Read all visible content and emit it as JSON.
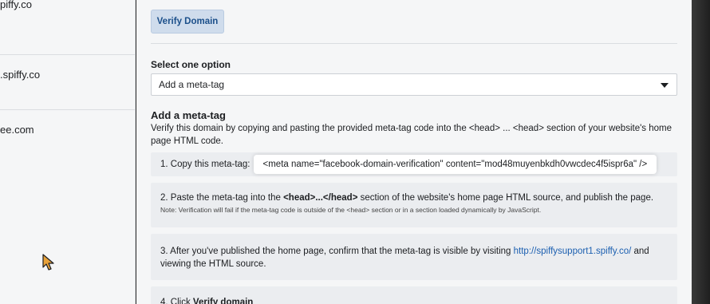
{
  "sidebar": {
    "items": [
      {
        "label": "piffy.co"
      },
      {
        "label": ".spiffy.co"
      },
      {
        "label": "ee.com"
      }
    ]
  },
  "main": {
    "verify_button": "Verify Domain",
    "select_label": "Select one option",
    "select_value": "Add a meta-tag",
    "section_title": "Add a meta-tag",
    "section_desc": "Verify this domain by copying and pasting the provided meta-tag code into the <head> ... <head> section of your website's home page HTML code.",
    "step1": {
      "prefix": "1. Copy this meta-tag:",
      "code": "<meta name=\"facebook-domain-verification\" content=\"mod48muyenbkdh0vwcdec4f5ispr6a\" />"
    },
    "step2": {
      "text_a": "2. Paste the meta-tag into the ",
      "text_bold": "<head>...</head>",
      "text_b": " section of the website's home page HTML source, and publish the page.",
      "note": "Note: Verification will fail if the meta-tag code is outside of the <head> section or in a section loaded dynamically by JavaScript."
    },
    "step3": {
      "text_a": "3. After you've published the home page, confirm that the meta-tag is visible by visiting ",
      "link": "http://spiffysupport1.spiffy.co/",
      "text_b": " and viewing the HTML source."
    },
    "step4": {
      "text_a": "4. Click ",
      "text_bold": "Verify domain"
    }
  },
  "colors": {
    "accent": "#1b5fb0",
    "button_bg": "#cfdcec",
    "panel_bg": "#f5f6f7",
    "step_bg": "#ebedf0"
  },
  "icons": {
    "cursor": "mouse-pointer-icon",
    "dropdown": "chevron-down-icon"
  }
}
